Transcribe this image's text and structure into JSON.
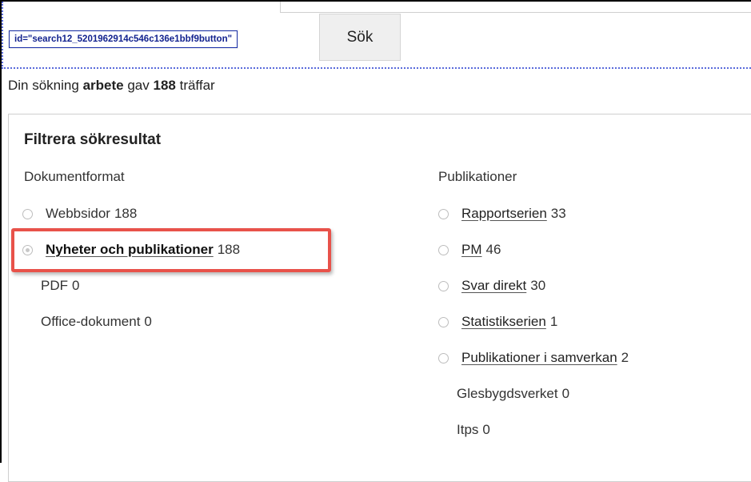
{
  "search": {
    "element_id_tag": "id=\"search12_5201962914c546c136e1bbf9button\"",
    "button_label": "Sök"
  },
  "summary": {
    "prefix": "Din sökning",
    "term": "arbete",
    "middle": "gav",
    "count": "188",
    "suffix": "träffar"
  },
  "filters": {
    "title": "Filtrera sökresultat",
    "document_format": {
      "heading": "Dokumentformat",
      "options": [
        {
          "label": "Webbsidor",
          "count": "188",
          "has_radio": true,
          "linked": false,
          "checked": false
        },
        {
          "label": "Nyheter och publikationer",
          "count": "188",
          "has_radio": true,
          "linked": true,
          "checked": true,
          "highlighted": true
        },
        {
          "label": "PDF",
          "count": "0",
          "has_radio": false,
          "linked": false
        },
        {
          "label": "Office-dokument",
          "count": "0",
          "has_radio": false,
          "linked": false
        }
      ]
    },
    "publications": {
      "heading": "Publikationer",
      "options": [
        {
          "label": "Rapportserien",
          "count": "33",
          "has_radio": true,
          "linked": true
        },
        {
          "label": "PM",
          "count": "46",
          "has_radio": true,
          "linked": true
        },
        {
          "label": "Svar direkt",
          "count": "30",
          "has_radio": true,
          "linked": true
        },
        {
          "label": "Statistikserien",
          "count": "1",
          "has_radio": true,
          "linked": true
        },
        {
          "label": "Publikationer i samverkan",
          "count": "2",
          "has_radio": true,
          "linked": true
        },
        {
          "label": "Glesbygdsverket",
          "count": "0",
          "has_radio": false,
          "linked": false
        },
        {
          "label": "Itps",
          "count": "0",
          "has_radio": false,
          "linked": false
        }
      ]
    }
  },
  "colors": {
    "highlight_border": "#e8524a",
    "dotted_outline": "#5a6bdb",
    "id_tag_text": "#13238f"
  }
}
